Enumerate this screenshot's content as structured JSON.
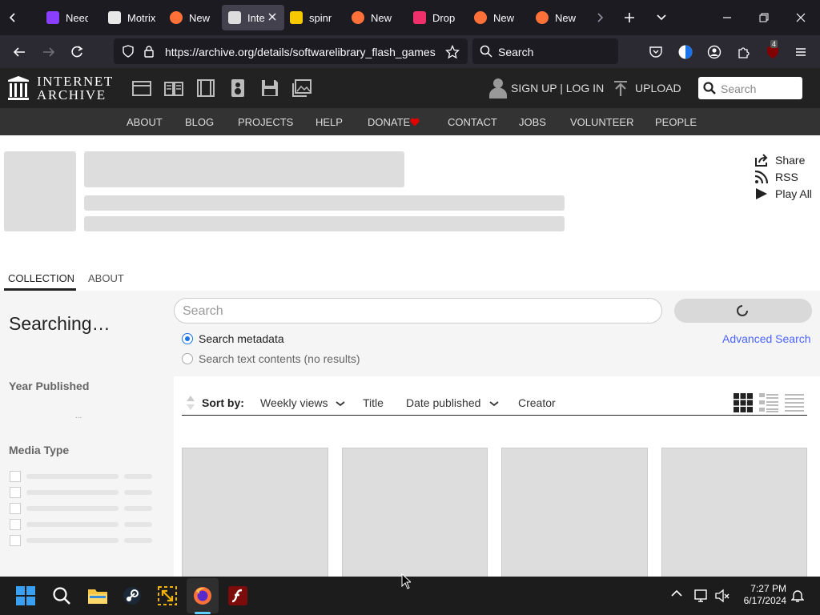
{
  "tabs": [
    {
      "label": "Need",
      "icon": "purple-app-icon",
      "color": "#8a3ffc"
    },
    {
      "label": "Motrix",
      "icon": "motrix-icon",
      "color": "#e8e8e8"
    },
    {
      "label": "New T",
      "icon": "firefox-icon",
      "color": "#ff7139"
    },
    {
      "label": "Inte",
      "icon": "internet-archive-icon",
      "color": "#ddd",
      "active": true
    },
    {
      "label": "spinn",
      "icon": "yellow-play-icon",
      "color": "#f6c900"
    },
    {
      "label": "New T",
      "icon": "firefox-icon",
      "color": "#ff7139"
    },
    {
      "label": "Dropl",
      "icon": "pink-arrow-icon",
      "color": "#f0306b"
    },
    {
      "label": "New T",
      "icon": "firefox-icon",
      "color": "#ff7139"
    },
    {
      "label": "New T",
      "icon": "firefox-icon",
      "color": "#ff7139"
    }
  ],
  "browser": {
    "url": "https://archive.org/details/softwarelibrary_flash_games",
    "search_placeholder": "Search",
    "ublock_badge": "4"
  },
  "ia": {
    "logo_line1": "INTERNET",
    "logo_line2": "ARCHIVE",
    "signup": "SIGN UP | LOG IN",
    "upload": "UPLOAD",
    "search_placeholder": "Search",
    "nav": [
      "ABOUT",
      "BLOG",
      "PROJECTS",
      "HELP",
      "DONATE",
      "CONTACT",
      "JOBS",
      "VOLUNTEER",
      "PEOPLE"
    ],
    "donate_heart_color": "#e50000"
  },
  "page": {
    "share": "Share",
    "rss": "RSS",
    "play_all": "Play All",
    "tab_collection": "COLLECTION",
    "tab_about": "ABOUT",
    "searching": "Searching…",
    "facet_year": "Year Published",
    "facet_year_loading": "...",
    "facet_media": "Media Type",
    "search_placeholder": "Search",
    "radio_metadata": "Search metadata",
    "radio_text": "Search text contents (no results)",
    "advanced_search": "Advanced Search",
    "sort_label": "Sort by:",
    "sort_options": [
      "Weekly views",
      "Title",
      "Date published",
      "Creator"
    ],
    "accent": "#4b64ff"
  },
  "taskbar": {
    "time": "7:27 PM",
    "date": "6/17/2024"
  }
}
